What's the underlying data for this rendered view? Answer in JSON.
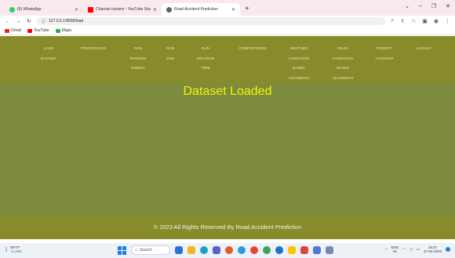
{
  "browser": {
    "tabs": [
      {
        "label": "(9) WhatsApp",
        "color": "#25d366",
        "active": false
      },
      {
        "label": "Channel content - YouTube Studio",
        "color": "#ff0000",
        "active": false
      },
      {
        "label": "Road Accident Prediction",
        "color": "#5f6368",
        "active": true
      }
    ],
    "new_tab_symbol": "+",
    "url": "127.0.0.1:8000/load",
    "bookmarks": [
      {
        "label": "Gmail",
        "color": "#d93025"
      },
      {
        "label": "YouTube",
        "color": "#ff0000"
      },
      {
        "label": "Maps",
        "color": "#34a853"
      }
    ]
  },
  "nav": {
    "items": [
      {
        "label": "LOAD\nDATASET"
      },
      {
        "label": "PREPROCESS"
      },
      {
        "label": "RUN\nRANDOM\nFOREST"
      },
      {
        "label": "RUN\nSVM"
      },
      {
        "label": "RUN\nDECISION\nTREE"
      },
      {
        "label": "COMPARISSION"
      },
      {
        "label": "WEATHER\nCONDITION\nBASED\nACCIDENTS"
      },
      {
        "label": "ROAD\nCONDITION\nBASED\nACCIDENTS"
      },
      {
        "label": "PREDICT\nACCIDENT"
      },
      {
        "label": "LOGOUT"
      }
    ]
  },
  "main": {
    "title": "Dataset Loaded"
  },
  "footer": {
    "text": "© 2023 All Rights Reserved By Road Accident Prediction"
  },
  "taskbar": {
    "weather_name": "NIFTY",
    "weather_change": "+1.24%",
    "search_placeholder": "Search",
    "lang_top": "ENG",
    "lang_bottom": "IN",
    "time": "18:47",
    "date": "27-04-2023"
  },
  "colors": {
    "page_bg": "#7c8c3c",
    "navbar_bg": "#878b2a",
    "title_color": "#f5f500"
  }
}
